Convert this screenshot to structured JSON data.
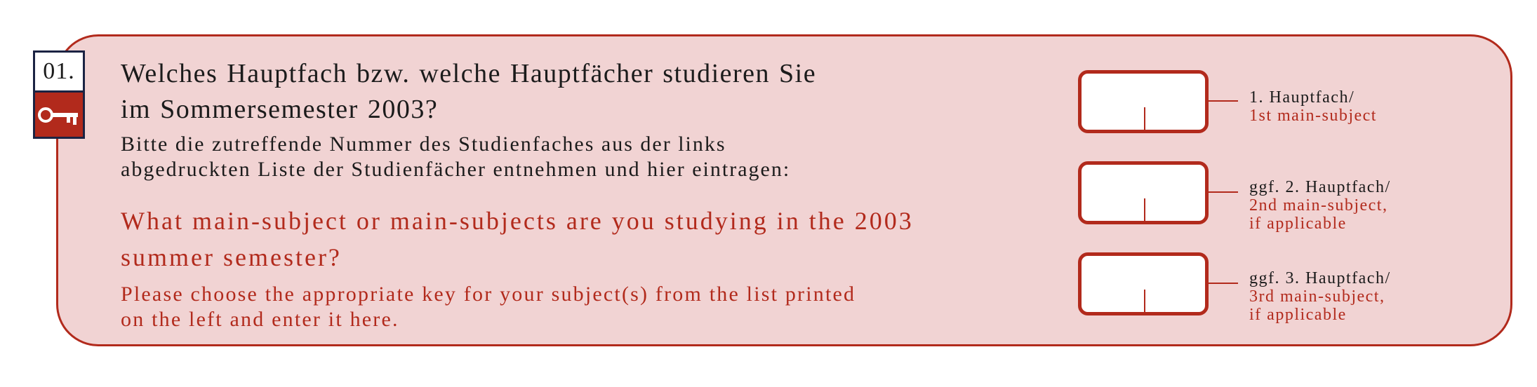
{
  "question": {
    "number": "01.",
    "de_line1": "Welches Hauptfach bzw. welche Hauptfächer studieren Sie",
    "de_line2": "im Sommersemester 2003?",
    "de_instr_line1": "Bitte die zutreffende Nummer des Studienfaches aus der links",
    "de_instr_line2": "abgedruckten Liste der Studienfächer entnehmen und hier eintragen:",
    "en_line1": "What main-subject or main-subjects are you studying in the 2003",
    "en_line2": "summer semester?",
    "en_instr_line1": "Please choose the appropriate key for your subject(s) from the list printed",
    "en_instr_line2": "on the left and enter it here."
  },
  "icons": {
    "key": "key-icon"
  },
  "colors": {
    "accent_red": "#b22a1c",
    "panel_pink": "#f1d3d3",
    "navy": "#1b2343"
  },
  "fields": [
    {
      "label_de": "1. Hauptfach/",
      "label_en_1": "1st main-subject",
      "label_en_2": ""
    },
    {
      "label_de": "ggf. 2. Hauptfach/",
      "label_en_1": "2nd main-subject,",
      "label_en_2": "if applicable"
    },
    {
      "label_de": "ggf. 3. Hauptfach/",
      "label_en_1": "3rd main-subject,",
      "label_en_2": "if applicable"
    }
  ]
}
